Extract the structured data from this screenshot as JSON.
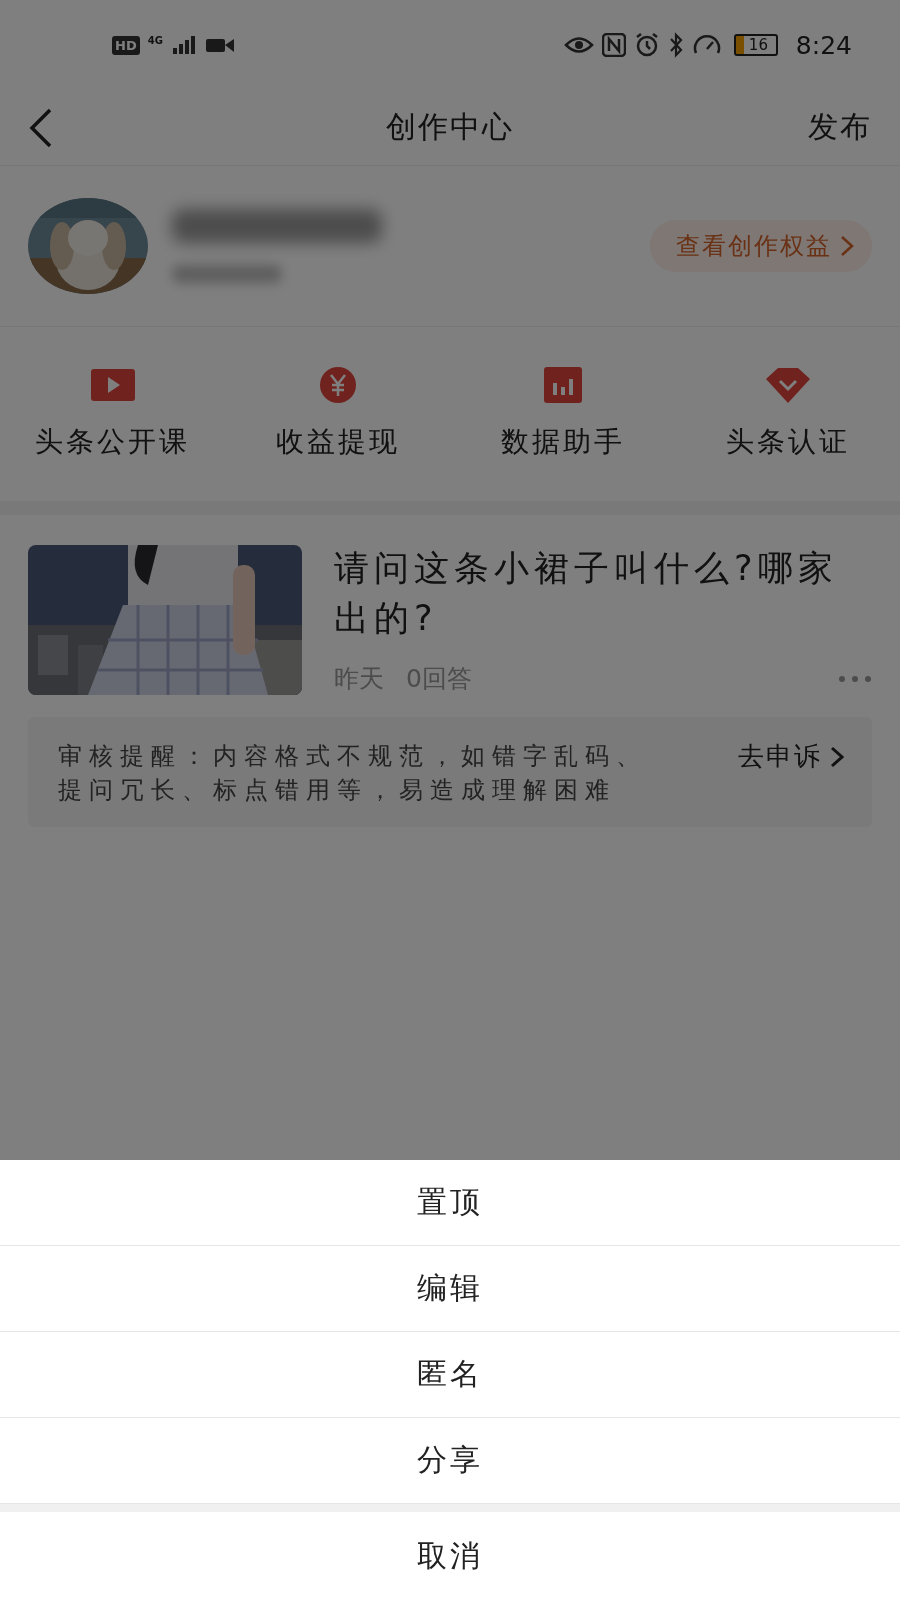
{
  "status_bar": {
    "badges": [
      "HD",
      "4G"
    ],
    "battery": "16",
    "time": "8:24"
  },
  "header": {
    "title": "创作中心",
    "action": "发布"
  },
  "profile": {
    "benefits_link": "查看创作权益"
  },
  "shortcuts": [
    {
      "label": "头条公开课"
    },
    {
      "label": "收益提现"
    },
    {
      "label": "数据助手"
    },
    {
      "label": "头条认证"
    }
  ],
  "post": {
    "title": "请问这条小裙子叫什么?哪家出的?",
    "time": "昨天",
    "answers": "0回答"
  },
  "review_notice": {
    "text": "审核提醒：内容格式不规范，如错字乱码、提问冗长、标点错用等，易造成理解困难",
    "action": "去申诉"
  },
  "action_sheet": {
    "items": [
      "置顶",
      "编辑",
      "匿名",
      "分享"
    ],
    "cancel": "取消"
  }
}
